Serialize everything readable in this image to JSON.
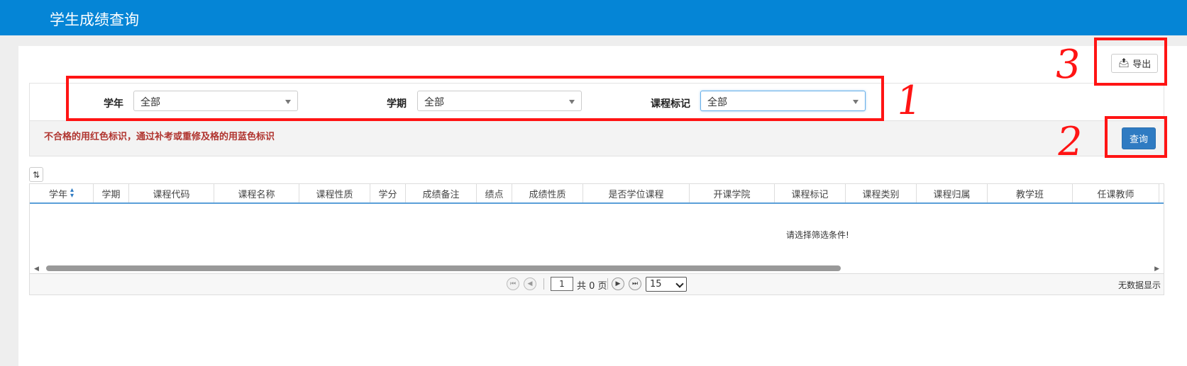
{
  "header": {
    "title": "学生成绩查询"
  },
  "toolbar": {
    "export_label": "导出",
    "query_label": "查询"
  },
  "filters": [
    {
      "label": "学年",
      "value": "全部"
    },
    {
      "label": "学期",
      "value": "全部"
    },
    {
      "label": "课程标记",
      "value": "全部"
    }
  ],
  "notice": "不合格的用红色标识，通过补考或重修及格的用蓝色标识",
  "table": {
    "columns": [
      "学年",
      "学期",
      "课程代码",
      "课程名称",
      "课程性质",
      "学分",
      "成绩备注",
      "绩点",
      "成绩性质",
      "是否学位课程",
      "开课学院",
      "课程标记",
      "课程类别",
      "课程归属",
      "教学班",
      "任课教师"
    ],
    "empty_message": "请选择筛选条件!"
  },
  "pager": {
    "current_page": "1",
    "total_text": "共 0 页",
    "page_size": "15",
    "info": "无数据显示"
  },
  "annotations": [
    "1",
    "2",
    "3"
  ],
  "colors": {
    "header_bg": "#0585d6",
    "annotation": "#ff1414",
    "primary_button": "#2f7bc2",
    "notice_text": "#b0342f"
  }
}
